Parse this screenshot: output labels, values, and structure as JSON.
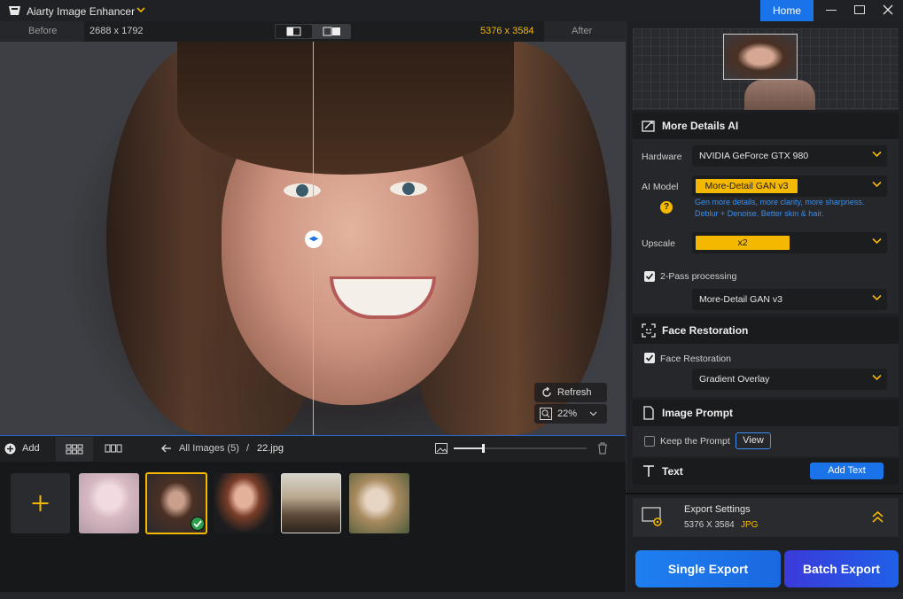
{
  "app": {
    "title": "Aiarty Image Enhancer",
    "home_label": "Home"
  },
  "compare": {
    "before_label": "Before",
    "before_res": "2688 x 1792",
    "after_res": "5376 x 3584",
    "after_label": "After"
  },
  "viewer": {
    "refresh_label": "Refresh",
    "zoom_value": "22%"
  },
  "bottombar": {
    "add_label": "Add",
    "breadcrumb_root": "All Images (5)",
    "breadcrumb_sep": "/",
    "breadcrumb_file": "22.jpg"
  },
  "panel": {
    "more_details": {
      "title": "More Details AI",
      "hardware_label": "Hardware",
      "hardware_value": "NVIDIA GeForce GTX 980",
      "model_label": "AI Model",
      "model_value": "More-Detail GAN  v3",
      "model_desc_1": "Gen more details, more clarity, more sharpness.",
      "model_desc_2": "Deblur + Denoise. Better skin & hair.",
      "upscale_label": "Upscale",
      "upscale_value": "x2",
      "twopass_label": "2-Pass processing",
      "twopass_value": "More-Detail GAN  v3"
    },
    "face_restoration": {
      "title": "Face Restoration",
      "check_label": "Face Restoration",
      "mode_value": "Gradient Overlay"
    },
    "image_prompt": {
      "title": "Image Prompt",
      "keep_label": "Keep the Prompt",
      "view_label": "View"
    },
    "text": {
      "title": "Text",
      "add_label": "Add Text"
    },
    "export": {
      "title": "Export Settings",
      "resolution": "5376 X 3584",
      "format": "JPG"
    },
    "single_export_label": "Single Export",
    "batch_export_label": "Batch Export"
  },
  "colors": {
    "accent": "#1a73e8",
    "yellow": "#f5b800",
    "selected_thumb": "#f5b800"
  }
}
